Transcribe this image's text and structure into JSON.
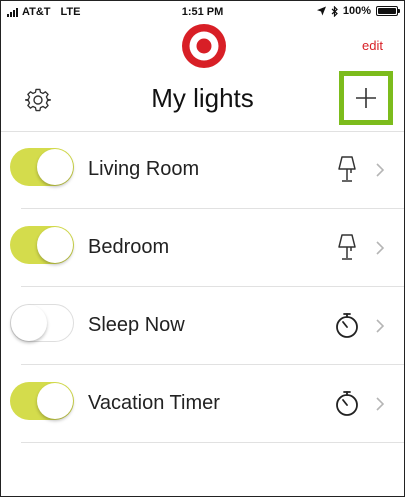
{
  "status_bar": {
    "carrier": "AT&T",
    "network": "LTE",
    "time": "1:51 PM",
    "battery_text": "100%",
    "battery_level": 1.0
  },
  "header": {
    "edit_label": "edit",
    "title": "My lights",
    "logo_icon": "bullseye-logo",
    "brand_color": "#d81f26",
    "highlight_color": "#7cbc1c"
  },
  "lights": [
    {
      "name": "Living Room",
      "on": true,
      "icon": "lamp-icon"
    },
    {
      "name": "Bedroom",
      "on": true,
      "icon": "lamp-icon"
    },
    {
      "name": "Sleep Now",
      "on": false,
      "icon": "timer-icon"
    },
    {
      "name": "Vacation Timer",
      "on": true,
      "icon": "timer-icon"
    }
  ],
  "colors": {
    "toggle_on": "#d4dc4c",
    "chevron": "#b5b5b5"
  }
}
